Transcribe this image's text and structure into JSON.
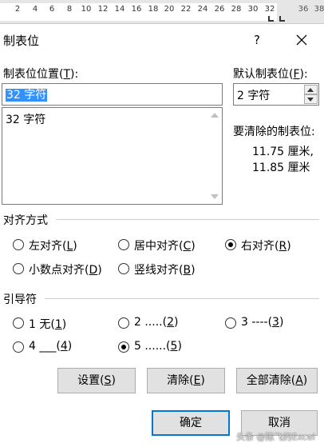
{
  "ruler": {
    "ticks": [
      "2",
      "4",
      "6",
      "8",
      "10",
      "12",
      "14",
      "16",
      "18",
      "20",
      "22",
      "24",
      "26",
      "28",
      "30",
      "32",
      "36",
      "38"
    ]
  },
  "dialog": {
    "title": "制表位",
    "help_label": "?",
    "close_label": "✕"
  },
  "tab_stop": {
    "label": "制表位位置(",
    "key": "T",
    "label_end": "):",
    "value": "32 字符",
    "list_items": [
      "32 字符"
    ]
  },
  "default_stop": {
    "label": "默认制表位(",
    "key": "F",
    "label_end": "):",
    "value": "2 字符"
  },
  "clear": {
    "label": "要清除的制表位:",
    "lines": [
      "11.75 厘米,",
      "11.85 厘米"
    ]
  },
  "alignment": {
    "heading": "对齐方式",
    "options": [
      {
        "label": "左对齐(",
        "key": "L",
        "end": ")",
        "checked": false
      },
      {
        "label": "居中对齐(",
        "key": "C",
        "end": ")",
        "checked": false
      },
      {
        "label": "右对齐(",
        "key": "R",
        "end": ")",
        "checked": true
      },
      {
        "label": "小数点对齐(",
        "key": "D",
        "end": ")",
        "checked": false
      },
      {
        "label": "竖线对齐(",
        "key": "B",
        "end": ")",
        "checked": false
      }
    ]
  },
  "leader": {
    "heading": "引导符",
    "options": [
      {
        "label": "1 无(",
        "key": "1",
        "end": ")",
        "checked": false
      },
      {
        "label": "2 .....(",
        "key": "2",
        "end": ")",
        "checked": false
      },
      {
        "label": "3 ----(",
        "key": "3",
        "end": ")",
        "checked": false
      },
      {
        "label": "4 ___(",
        "key": "4",
        "end": ")",
        "checked": false
      },
      {
        "label": "5 ......(",
        "key": "5",
        "end": ")",
        "checked": true
      }
    ]
  },
  "buttons": {
    "set": {
      "label": "设置(",
      "key": "S",
      "end": ")"
    },
    "clear": {
      "label": "清除(",
      "key": "E",
      "end": ")"
    },
    "clear_all": {
      "label": "全部清除(",
      "key": "A",
      "end": ")"
    },
    "ok": "确定",
    "cancel": "取消"
  },
  "watermark": "头条 @陈飞的Excel"
}
